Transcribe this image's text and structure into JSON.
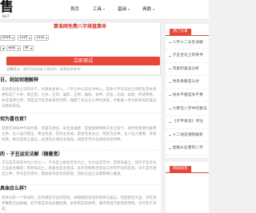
{
  "theme": {
    "accent": "#e8473a",
    "title_color": "#d6332b"
  },
  "icons": {
    "dropdown": "chevron-down-icon",
    "list_bullet": "dash-icon"
  },
  "header": {
    "logo": "售",
    "logo_sub": ".NET",
    "nav": [
      {
        "label": "首页"
      },
      {
        "label": "工具"
      },
      {
        "label": "基础"
      },
      {
        "label": "典籍"
      }
    ]
  },
  "form": {
    "title": "算准网免费八字排盘算命",
    "year": "2026",
    "month": "12月",
    "day": "31日",
    "hour": "未知",
    "gender": "男",
    "submit_label": "立即测试",
    "tip": "温馨提示：程序目前还处于测试中，结果仅供参考！"
  },
  "articles": [
    {
      "title": "日，则如何理解神",
      "summary": "日主即出生之日的天干，代表命主本人。八字之中以日主为中心，其余七字与日主之间的生克关系便形成了十神，即正官、七杀、正印、偏印、正财、偏财、食神、伤官、比肩、劫财。所谓神者，并非鬼神之神，而是五行生克关系的代称，理解了日主与十神的关系，才能进一步分析命局的喜忌与格局高低。"
    },
    {
      "title": "何为喜也官？",
      "summary": "官星在命局中代表约束、名誉与地位。日主身强者，官星能够制衡日主之旺气，此时官星便为喜用之神，主人品行端正、事业有成；若日主身弱，官星克身太过，则反为忌神，主人压力重重、多受拘束。故论官星之喜忌，必须先分清日主强弱，再结合月令与格局综合判断。"
    },
    {
      "title": "的 · 子丑运论法解（随着宽）",
      "summary": "子与丑在地支中为六合之一，子水丑土相合可化为土。论大运流年时，若原局喜土，则行子丑合化之运多主顺遂；若原局忌土，则逢合反主阻滞。此外还要看合而化与合而不化的区别，天干是否透出土神、月令是否得令，都会影响合化的成败，因此论运之法需要细心推敲。"
    },
    {
      "title": "具体应么样？",
      "summary": "具体分析一个命局时，应先确定日主的旺衰，再根据旺衰选取用神与喜忌，然后结合大运、流年逐步推断吉凶祸福。初学者宜多读古籍经典，多参照实际命例，循序渐进方能有所领悟，切勿急于求成。"
    }
  ],
  "sidebar": {
    "hot_title": "热门文章",
    "hot_items": [
      {
        "label": "八字十二长生详解"
      },
      {
        "label": "子丑合化土的条件"
      },
      {
        "label": "印星的喜忌分析"
      },
      {
        "label": "财多身弱怎么办"
      },
      {
        "label": "财多不富官多不贵"
      },
      {
        "label": "六亲在八字中的看法"
      },
      {
        "label": "《子平真诠》评注"
      },
      {
        "label": "十二地支相刑解析"
      },
      {
        "label": "金融从业者的八字"
      }
    ],
    "tags_title": "网站标签"
  }
}
